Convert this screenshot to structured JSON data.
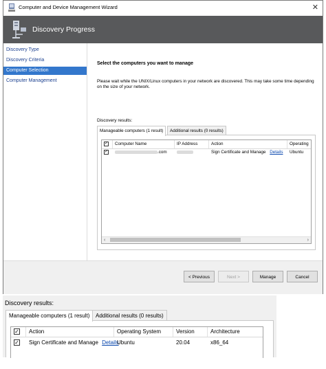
{
  "window": {
    "title": "Computer and Device Management Wizard",
    "close_glyph": "✕",
    "header_title": "Discovery Progress"
  },
  "nav": {
    "items": [
      {
        "label": "Discovery Type",
        "selected": false
      },
      {
        "label": "Discovery Criteria",
        "selected": false
      },
      {
        "label": "Computer Selection",
        "selected": true
      },
      {
        "label": "Computer Management",
        "selected": false
      }
    ]
  },
  "content": {
    "heading": "Select the computers you want to manage",
    "description": "Please wait while the UNIX/Linux computers in your network are discovered. This may take some time depending on the size of your network.",
    "results_label": "Discovery results:",
    "tabs": [
      "Manageable computers (1 result)",
      "Additional results (0 results)"
    ],
    "grid": {
      "headers": [
        "✓",
        "Computer Name",
        "IP Address",
        "Action",
        "Operating"
      ],
      "row": {
        "checked": "✓",
        "computer_name_suffix": ".com",
        "action": "Sign Certificate and Manage",
        "details": "Details",
        "os": "Ubuntu"
      }
    }
  },
  "footer": {
    "previous": "< Previous",
    "next": "Next >",
    "manage": "Manage",
    "cancel": "Cancel"
  },
  "zoom": {
    "results_label": "Discovery results:",
    "tabs": [
      "Manageable computers (1 result)",
      "Additional results (0 results)"
    ],
    "headers": [
      "✓",
      "Action",
      "Operating System",
      "Version",
      "Architecture"
    ],
    "row": {
      "checked": "✓",
      "action": "Sign Certificate and Manage",
      "details": "Details",
      "os": "Ubuntu",
      "version": "20.04",
      "architecture": "x86_64"
    }
  },
  "icons": {
    "scroll_left": "‹",
    "scroll_right": "›"
  },
  "colors": {
    "header_bg": "#58595b",
    "nav_selected": "#3377cc",
    "link": "#0645ad"
  }
}
